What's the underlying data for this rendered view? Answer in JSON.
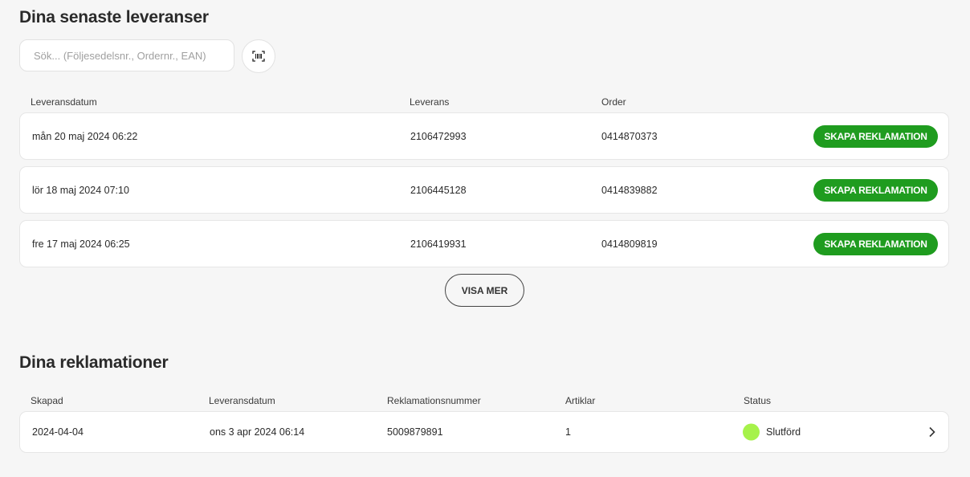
{
  "deliveries": {
    "title": "Dina senaste leveranser",
    "search_placeholder": "Sök... (Följesedelsnr., Ordernr., EAN)",
    "columns": [
      "Leveransdatum",
      "Leverans",
      "Order"
    ],
    "rows": [
      {
        "date": "mån 20 maj 2024 06:22",
        "delivery": "2106472993",
        "order": "0414870373",
        "action": "SKAPA REKLAMATION"
      },
      {
        "date": "lör 18 maj 2024 07:10",
        "delivery": "2106445128",
        "order": "0414839882",
        "action": "SKAPA REKLAMATION"
      },
      {
        "date": "fre 17 maj 2024 06:25",
        "delivery": "2106419931",
        "order": "0414809819",
        "action": "SKAPA REKLAMATION"
      }
    ],
    "show_more_label": "VISA MER"
  },
  "claims": {
    "title": "Dina reklamationer",
    "columns": [
      "Skapad",
      "Leveransdatum",
      "Reklamationsnummer",
      "Artiklar",
      "Status"
    ],
    "rows": [
      {
        "created": "2024-04-04",
        "delivery_date": "ons 3 apr 2024 06:14",
        "claim_number": "5009879891",
        "articles": "1",
        "status": "Slutförd",
        "status_color": "#a6f24a"
      }
    ]
  },
  "colors": {
    "accent": "#1f9c1f",
    "background": "#f6f6f6"
  },
  "icons": {
    "scan": "barcode-scan-icon",
    "row_link": "chevron-right-icon"
  }
}
